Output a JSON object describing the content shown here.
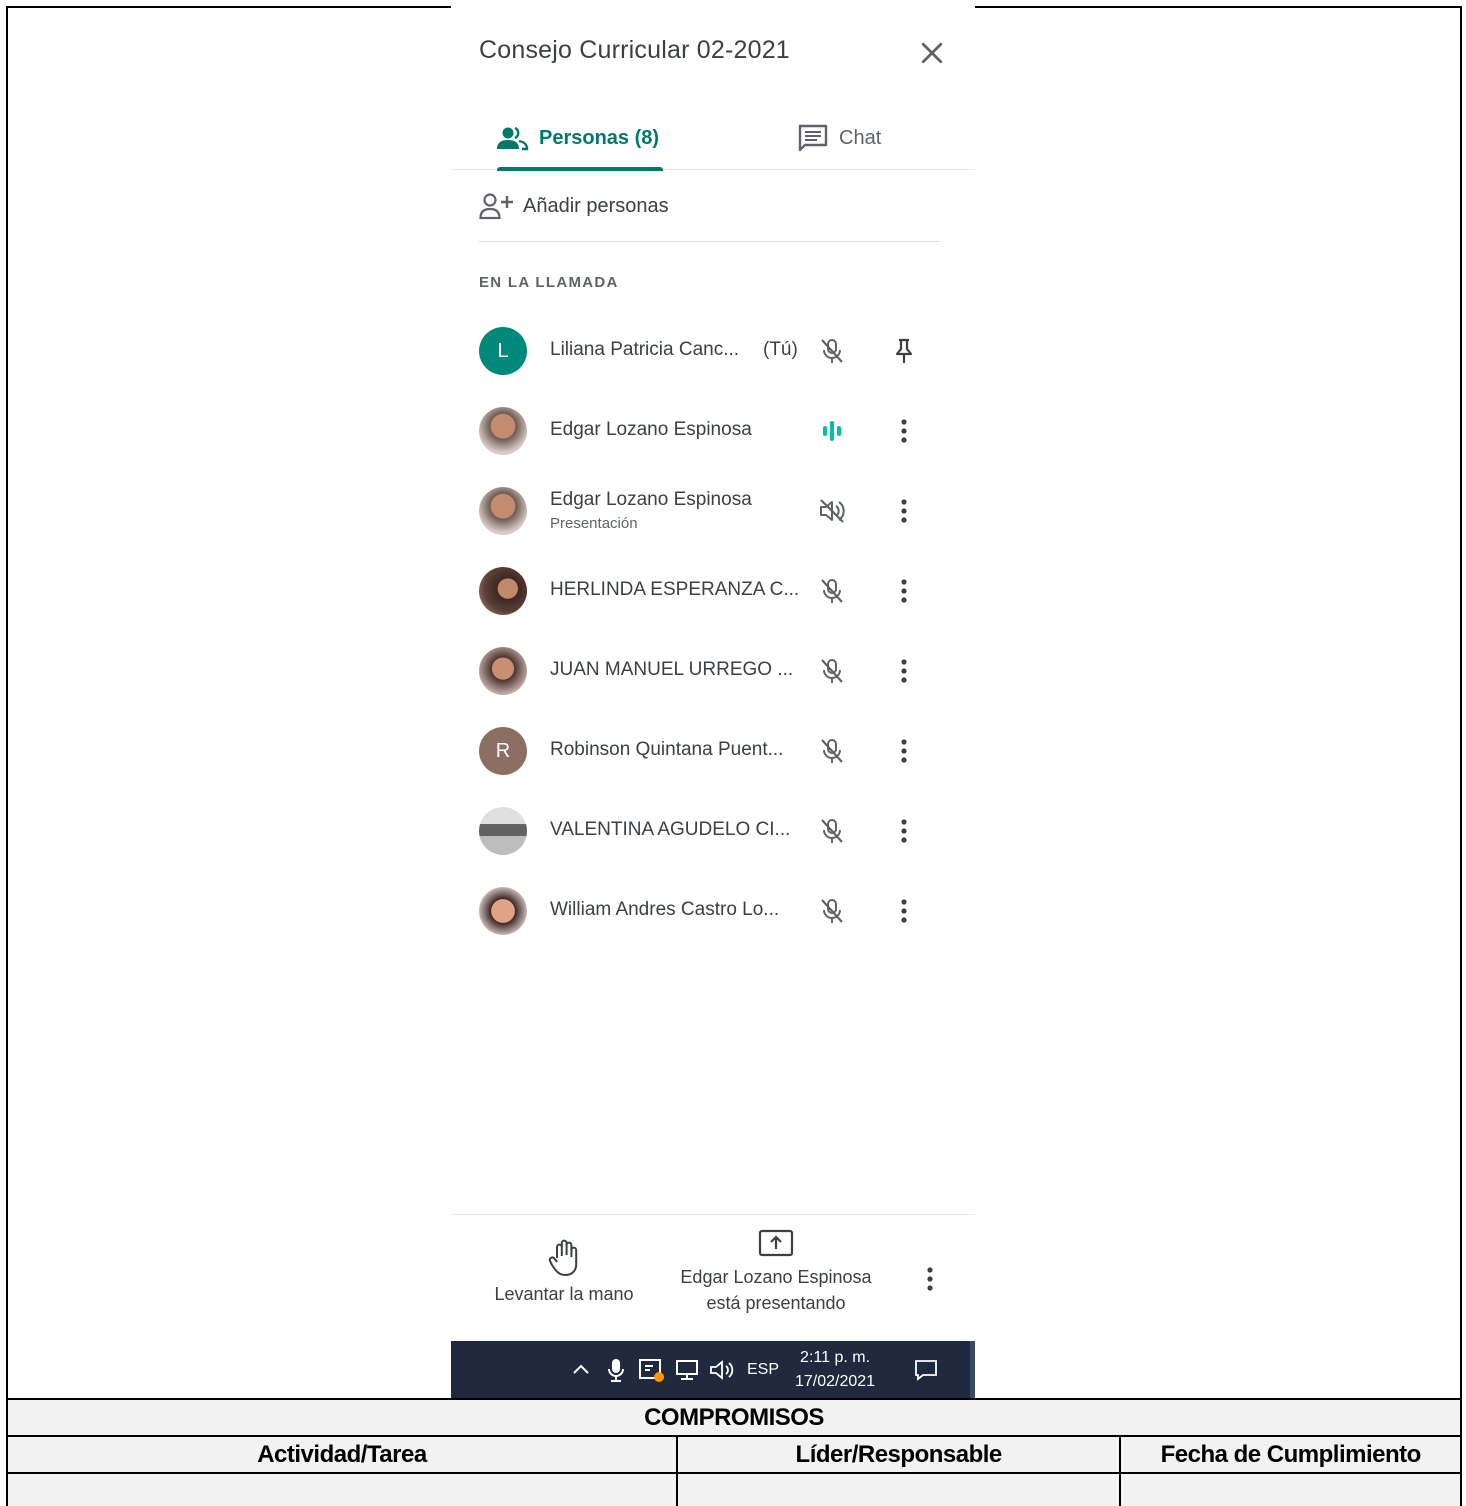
{
  "meeting": {
    "title": "Consejo Curricular 02-2021"
  },
  "tabs": {
    "people_label": "Personas (8)",
    "chat_label": "Chat"
  },
  "add_people_label": "Añadir personas",
  "section_label": "EN LA LLAMADA",
  "participants": [
    {
      "name": "Liliana Patricia Canc...",
      "suffix": "(Tú)",
      "sub": "",
      "initial": "L",
      "avatar_color": "#00897b",
      "mic": "muted",
      "action": "pin"
    },
    {
      "name": "Edgar Lozano Espinosa",
      "suffix": "",
      "sub": "",
      "initial": "",
      "avatar_color": "#8d6e63",
      "mic": "speaking",
      "action": "more"
    },
    {
      "name": "Edgar Lozano Espinosa",
      "suffix": "",
      "sub": "Presentación",
      "initial": "",
      "avatar_color": "#8d6e63",
      "mic": "audio-off",
      "action": "more"
    },
    {
      "name": "HERLINDA ESPERANZA C...",
      "suffix": "",
      "sub": "",
      "initial": "",
      "avatar_color": "#6d4c41",
      "mic": "muted",
      "action": "more"
    },
    {
      "name": "JUAN MANUEL URREGO ...",
      "suffix": "",
      "sub": "",
      "initial": "",
      "avatar_color": "#795548",
      "mic": "muted",
      "action": "more"
    },
    {
      "name": "Robinson Quintana Puent...",
      "suffix": "",
      "sub": "",
      "initial": "R",
      "avatar_color": "#8d6e63",
      "mic": "muted",
      "action": "more"
    },
    {
      "name": "VALENTINA AGUDELO CI...",
      "suffix": "",
      "sub": "",
      "initial": "",
      "avatar_color": "#9e9e9e",
      "mic": "muted",
      "action": "more"
    },
    {
      "name": "William Andres Castro Lo...",
      "suffix": "",
      "sub": "",
      "initial": "",
      "avatar_color": "#a1887f",
      "mic": "muted",
      "action": "more"
    }
  ],
  "bottom_bar": {
    "raise_hand_label": "Levantar la mano",
    "presenting_line1": "Edgar Lozano Espinosa",
    "presenting_line2": "está presentando"
  },
  "taskbar": {
    "language": "ESP",
    "time": "2:11 p. m.",
    "date": "17/02/2021",
    "bg_color": "#1f2a3f"
  },
  "commitments": {
    "title": "COMPROMISOS",
    "columns": [
      "Actividad/Tarea",
      "Líder/Responsable",
      "Fecha de Cumplimiento"
    ]
  },
  "colors": {
    "accent": "#00796b",
    "speaking": "#00bfa5"
  }
}
